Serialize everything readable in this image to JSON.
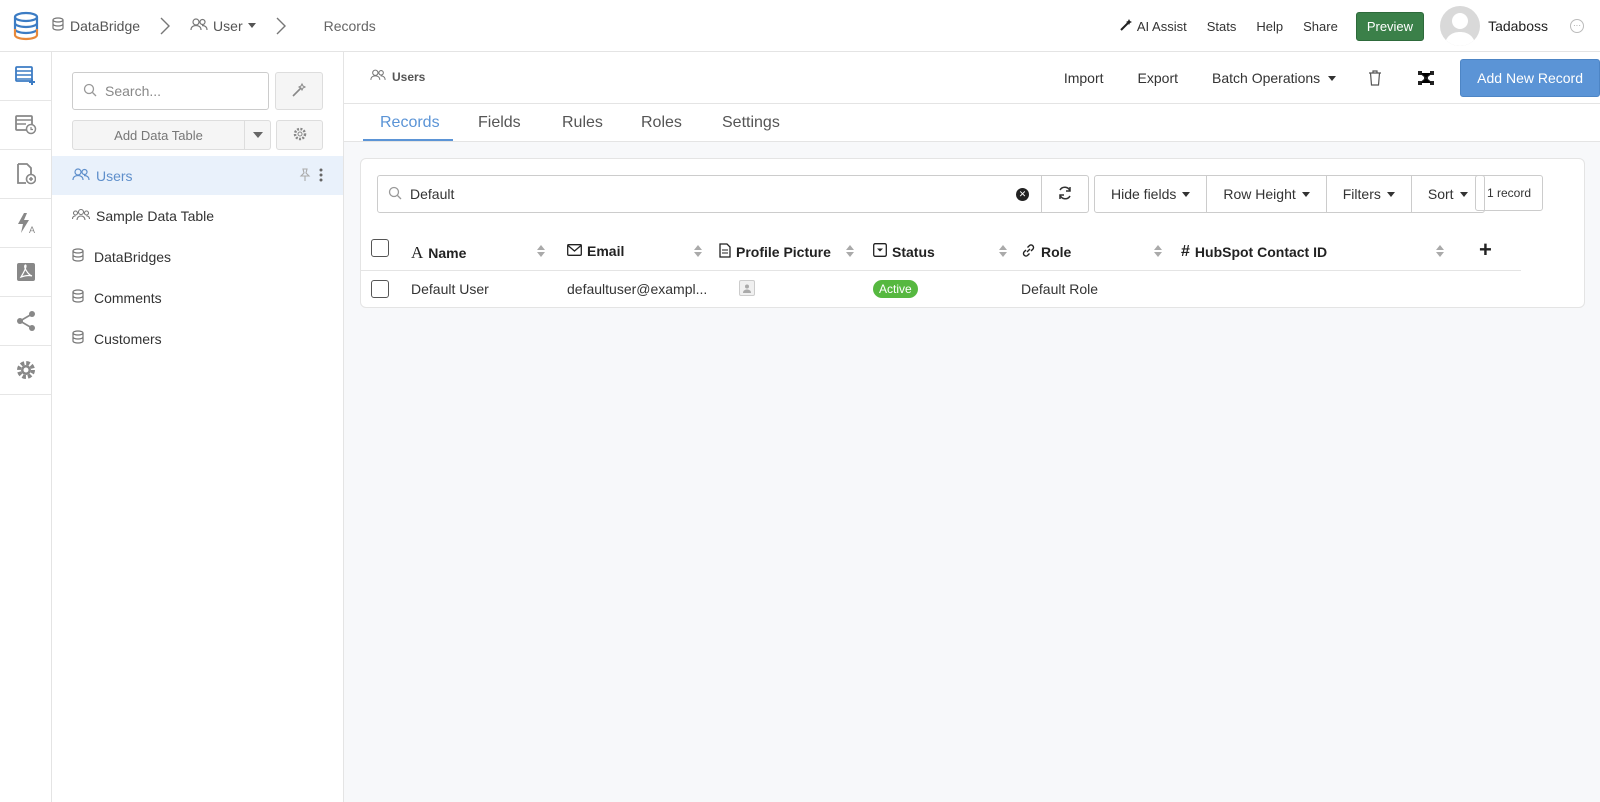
{
  "topbar": {
    "breadcrumb": [
      "DataBridge",
      "User",
      "Records"
    ],
    "links": {
      "ai_assist": "AI Assist",
      "stats": "Stats",
      "help": "Help",
      "share": "Share"
    },
    "preview_label": "Preview",
    "user_name": "Tadaboss"
  },
  "sidebar": {
    "search_placeholder": "Search...",
    "add_table_label": "Add Data Table",
    "items": [
      {
        "label": "Users",
        "icon": "users-icon",
        "active": true
      },
      {
        "label": "Sample Data Table",
        "icon": "users-group-icon"
      },
      {
        "label": "DataBridges",
        "icon": "database-icon"
      },
      {
        "label": "Comments",
        "icon": "database-icon"
      },
      {
        "label": "Customers",
        "icon": "database-icon"
      }
    ]
  },
  "main": {
    "table_title": "Users",
    "actions": {
      "import": "Import",
      "export": "Export",
      "batch": "Batch Operations",
      "add_record": "Add New Record"
    },
    "tabs": [
      "Records",
      "Fields",
      "Rules",
      "Roles",
      "Settings"
    ],
    "active_tab": "Records",
    "filter_value": "Default",
    "toolbar": {
      "hide_fields": "Hide fields",
      "row_height": "Row Height",
      "filters": "Filters",
      "sort": "Sort"
    },
    "record_count": "1 record",
    "columns": [
      "Name",
      "Email",
      "Profile Picture",
      "Status",
      "Role",
      "HubSpot Contact ID"
    ],
    "rows": [
      {
        "name": "Default User",
        "email": "defaultuser@exampl...",
        "status": "Active",
        "role": "Default Role",
        "hubspot": ""
      }
    ]
  },
  "colors": {
    "accent": "#5b94d6",
    "preview_green": "#3b8049",
    "active_badge": "#56b840"
  }
}
